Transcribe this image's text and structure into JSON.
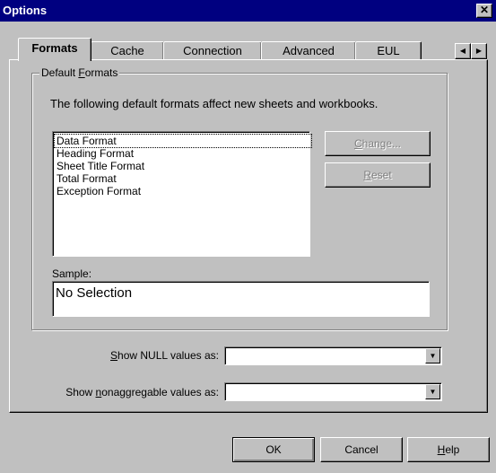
{
  "window": {
    "title": "Options",
    "close_glyph": "✕"
  },
  "tabs": [
    {
      "label": "Formats",
      "active": true
    },
    {
      "label": "Cache",
      "active": false
    },
    {
      "label": "Connection",
      "active": false
    },
    {
      "label": "Advanced",
      "active": false
    },
    {
      "label": "EUL",
      "active": false
    }
  ],
  "tab_scroll": {
    "left": "◀",
    "right": "▶"
  },
  "default_formats": {
    "group_label_pre": "Default ",
    "group_label_key": "F",
    "group_label_post": "ormats",
    "description": "The following default formats affect new sheets and workbooks.",
    "items": [
      "Data Format",
      "Heading Format",
      "Sheet Title Format",
      "Total Format",
      "Exception Format"
    ],
    "change_key": "C",
    "change_rest": "hange...",
    "reset_key": "R",
    "reset_rest": "eset",
    "sample_label": "Sample:",
    "sample_value": "No Selection"
  },
  "null_row": {
    "label_key": "S",
    "label_rest": "how NULL values as:",
    "value": ""
  },
  "nonagg_row": {
    "label_pre": "Show ",
    "label_key": "n",
    "label_rest": "onaggregable values as:",
    "value": ""
  },
  "combo_arrow": "▼",
  "footer": {
    "ok": "OK",
    "cancel": "Cancel",
    "help_key": "H",
    "help_rest": "elp"
  }
}
